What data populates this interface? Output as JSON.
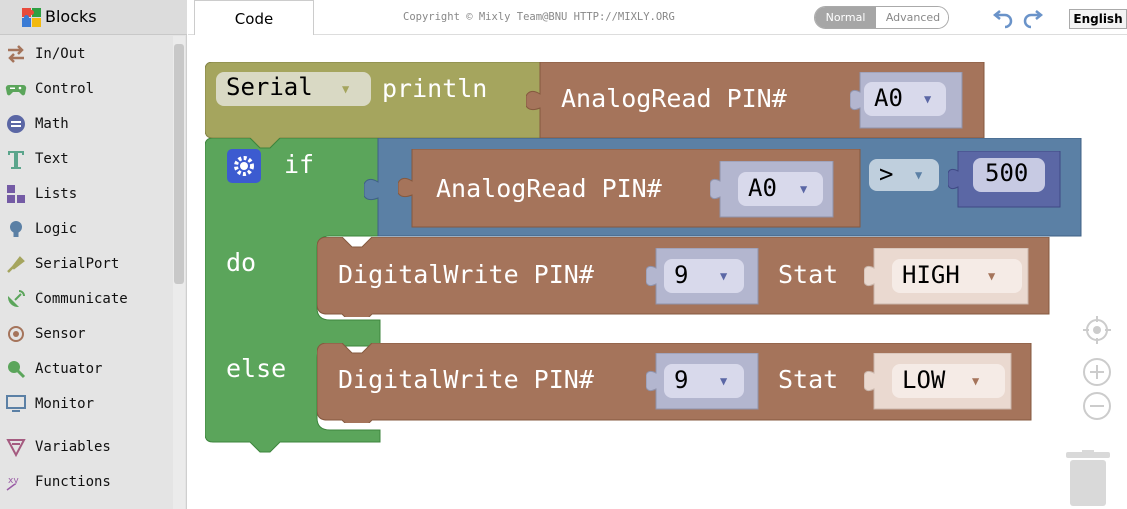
{
  "sidebar": {
    "title": "Blocks",
    "categories": [
      {
        "label": "In/Out",
        "icon": "in-out-icon"
      },
      {
        "label": "Control",
        "icon": "gamepad-icon"
      },
      {
        "label": "Math",
        "icon": "math-icon"
      },
      {
        "label": "Text",
        "icon": "text-t-icon"
      },
      {
        "label": "Lists",
        "icon": "lists-icon"
      },
      {
        "label": "Logic",
        "icon": "bulb-icon"
      },
      {
        "label": "SerialPort",
        "icon": "serialport-icon"
      },
      {
        "label": "Communicate",
        "icon": "satellite-icon"
      },
      {
        "label": "Sensor",
        "icon": "sensor-icon"
      },
      {
        "label": "Actuator",
        "icon": "actuator-icon"
      },
      {
        "label": "Monitor",
        "icon": "monitor-icon"
      },
      {
        "label": "Variables",
        "icon": "variables-icon"
      },
      {
        "label": "Functions",
        "icon": "functions-icon"
      }
    ]
  },
  "topbar": {
    "tab_code": "Code",
    "copyright": "Copyright © Mixly Team@BNU HTTP://MIXLY.ORG",
    "mode_normal": "Normal",
    "mode_advanced": "Advanced",
    "language": "English"
  },
  "blocks": {
    "serial": {
      "dropdown": "Serial",
      "action": "println"
    },
    "analogread_top": {
      "label": "AnalogRead PIN#",
      "pin": "A0"
    },
    "if_block": {
      "if_label": "if",
      "do_label": "do",
      "else_label": "else"
    },
    "compare": {
      "left_label": "AnalogRead PIN#",
      "left_pin": "A0",
      "operator": ">",
      "right_value": "500"
    },
    "dw_do": {
      "label": "DigitalWrite PIN#",
      "pin": "9",
      "stat_label": "Stat",
      "stat": "HIGH"
    },
    "dw_else": {
      "label": "DigitalWrite PIN#",
      "pin": "9",
      "stat_label": "Stat",
      "stat": "LOW"
    }
  },
  "colors": {
    "serial_block": "#a5a55e",
    "io_block": "#a5745b",
    "control_block": "#5ba55b",
    "logic_block": "#5b80a5",
    "math_block": "#5b67a5",
    "dropdown_bg": "#d8d9eb",
    "stat_dropdown_bg": "#ead9d0"
  },
  "dropdown_arrow": "▼"
}
